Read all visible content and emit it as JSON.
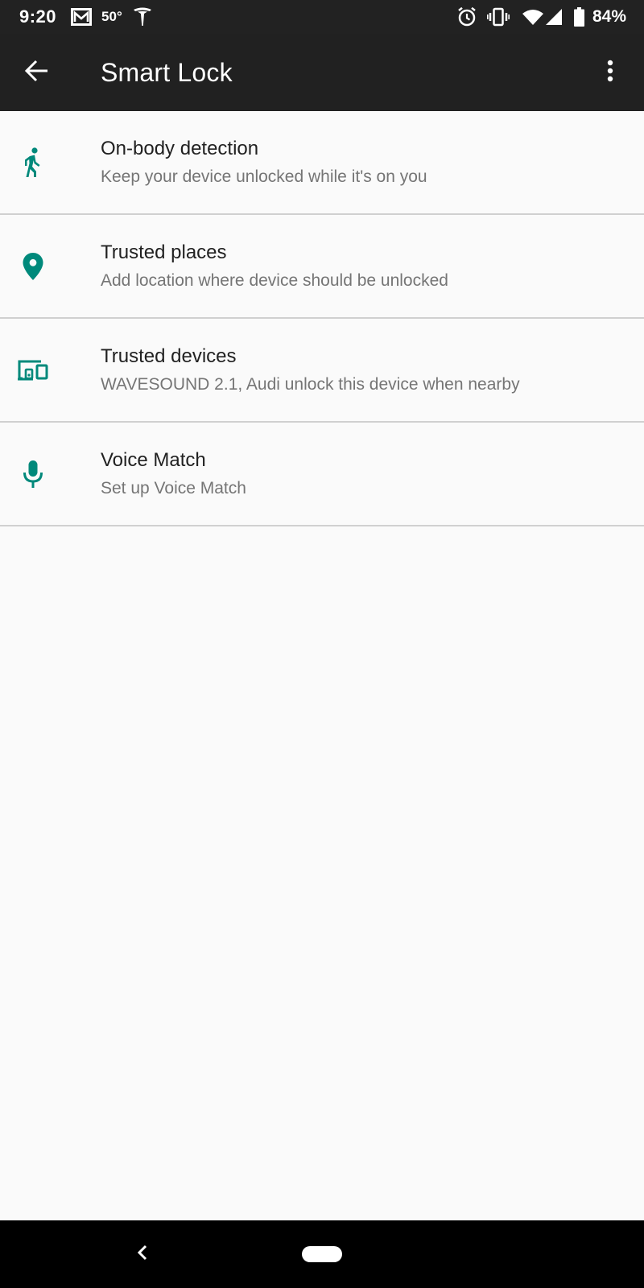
{
  "status_bar": {
    "time": "9:20",
    "temperature": "50°",
    "battery_percent": "84%",
    "icons": [
      "gmail-icon",
      "tesla-icon",
      "alarm-icon",
      "vibrate-icon",
      "wifi-icon",
      "signal-icon",
      "battery-icon"
    ]
  },
  "app_bar": {
    "title": "Smart Lock",
    "back_icon": "arrow-back-icon",
    "menu_icon": "more-vert-icon"
  },
  "items": [
    {
      "title": "On-body detection",
      "subtitle": "Keep your device unlocked while it's on you",
      "icon": "walking-person-icon"
    },
    {
      "title": "Trusted places",
      "subtitle": "Add location where device should be unlocked",
      "icon": "location-pin-icon"
    },
    {
      "title": "Trusted devices",
      "subtitle": "WAVESOUND 2.1, Audi unlock this device when nearby",
      "icon": "devices-icon"
    },
    {
      "title": "Voice Match",
      "subtitle": "Set up Voice Match",
      "icon": "microphone-icon"
    }
  ],
  "colors": {
    "accent": "#00897b",
    "app_bar": "#212121",
    "status_bar": "#222222",
    "background": "#fafafa",
    "divider": "#d0d0d0",
    "title_text": "#212121",
    "subtitle_text": "#757575"
  },
  "nav_bar": {
    "icons": [
      "nav-back-icon",
      "home-pill-icon"
    ]
  }
}
